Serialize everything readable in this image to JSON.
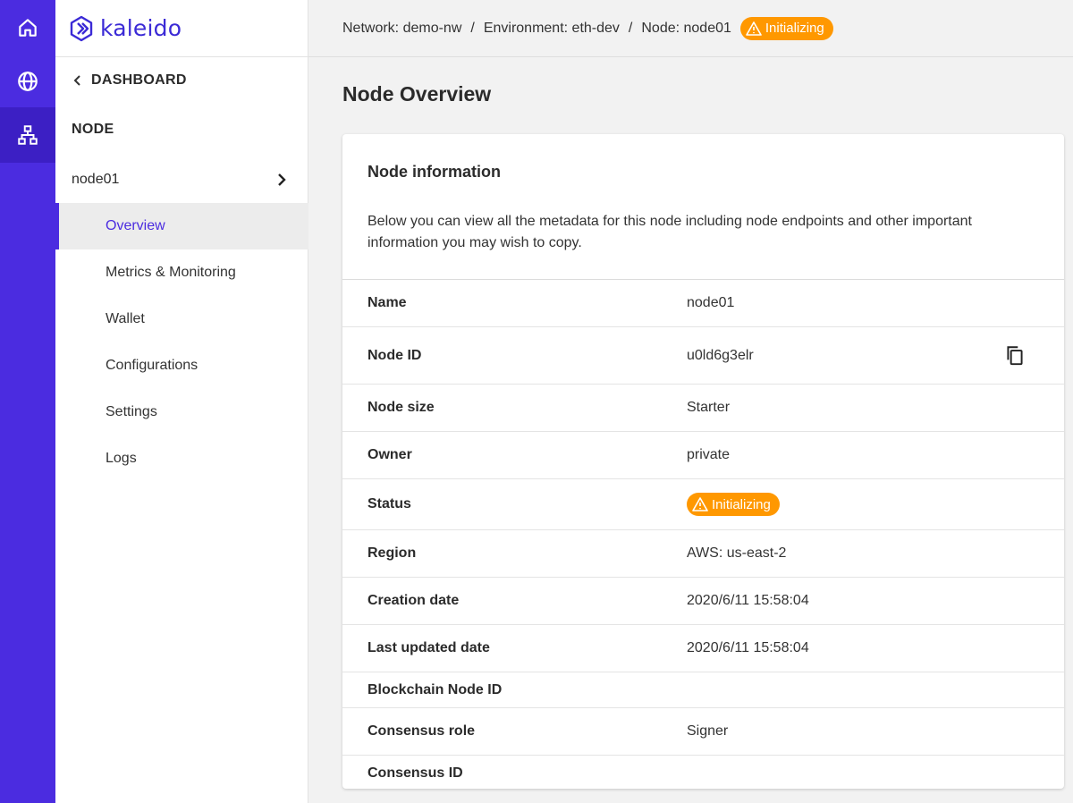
{
  "rail": {
    "items": [
      {
        "icon": "home-icon"
      },
      {
        "icon": "globe-icon"
      },
      {
        "icon": "network-icon",
        "active": true
      }
    ]
  },
  "sidebar": {
    "logo_text": "kaleido",
    "back_label": "DASHBOARD",
    "section_heading": "NODE",
    "node_label": "node01",
    "nav": [
      {
        "label": "Overview",
        "active": true
      },
      {
        "label": "Metrics & Monitoring"
      },
      {
        "label": "Wallet"
      },
      {
        "label": "Configurations"
      },
      {
        "label": "Settings"
      },
      {
        "label": "Logs"
      }
    ]
  },
  "breadcrumb": {
    "network": "Network: demo-nw",
    "environment": "Environment: eth-dev",
    "node": "Node: node01",
    "separator": "/",
    "status": "Initializing"
  },
  "page": {
    "title": "Node Overview"
  },
  "card": {
    "title": "Node information",
    "description": "Below you can view all the metadata for this node including node endpoints and other important information you may wish to copy.",
    "rows": [
      {
        "label": "Name",
        "value": "node01"
      },
      {
        "label": "Node ID",
        "value": "u0ld6g3elr",
        "copy": true
      },
      {
        "label": "Node size",
        "value": "Starter"
      },
      {
        "label": "Owner",
        "value": "private"
      },
      {
        "label": "Status",
        "value": "Initializing",
        "badge": true
      },
      {
        "label": "Region",
        "value": "AWS: us-east-2"
      },
      {
        "label": "Creation date",
        "value": "2020/6/11 15:58:04"
      },
      {
        "label": "Last updated date",
        "value": "2020/6/11 15:58:04"
      },
      {
        "label": "Blockchain Node ID",
        "value": ""
      },
      {
        "label": "Consensus role",
        "value": "Signer"
      },
      {
        "label": "Consensus ID",
        "value": ""
      }
    ]
  },
  "colors": {
    "rail": "#4b2ce0",
    "accent": "#4b2ce0",
    "warning": "#ff9800"
  }
}
